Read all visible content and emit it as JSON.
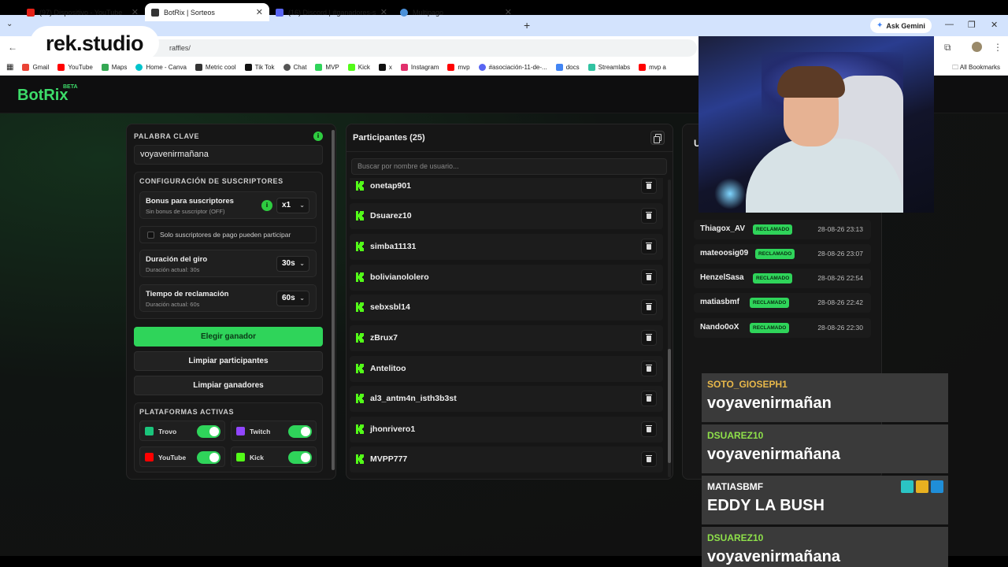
{
  "browser": {
    "tabs": [
      {
        "title": "(97) Dispositivo - YouTube",
        "color": "#e62117"
      },
      {
        "title": "BotRix | Sorteos",
        "color": "#333333"
      },
      {
        "title": "(16) Discord | #ganadores-sorteo",
        "color": "#5865f2"
      },
      {
        "title": "Multipago",
        "color": "#4a90d9"
      }
    ],
    "ask_gemini": "Ask Gemini",
    "url": "raffles/",
    "bookmarks": [
      {
        "label": "Gmail",
        "color": "#ea4335"
      },
      {
        "label": "YouTube",
        "color": "#ff0000"
      },
      {
        "label": "Maps",
        "color": "#34a853"
      },
      {
        "label": "Home - Canva",
        "color": "#00c4cc"
      },
      {
        "label": "Metric cool",
        "color": "#333333"
      },
      {
        "label": "Tik Tok",
        "color": "#111111"
      },
      {
        "label": "Chat",
        "color": "#555555"
      },
      {
        "label": "MVP",
        "color": "#2fd45a"
      },
      {
        "label": "Kick",
        "color": "#53fc18"
      },
      {
        "label": "x",
        "color": "#111111"
      },
      {
        "label": "Instagram",
        "color": "#e1306c"
      },
      {
        "label": "mvp",
        "color": "#ff0000"
      },
      {
        "label": "#asociación-11-de-...",
        "color": "#5865f2"
      },
      {
        "label": "docs",
        "color": "#4285f4"
      },
      {
        "label": "Streamlabs",
        "color": "#31c3a2"
      },
      {
        "label": "mvp a",
        "color": "#ff0000"
      }
    ],
    "all_bookmarks": "All Bookmarks"
  },
  "overlay": {
    "logo_text": "rek.studio"
  },
  "app": {
    "brand": "BotRix",
    "beta": "BETA",
    "keyword": {
      "label": "PALABRA CLAVE",
      "value": "voyavenirmañana"
    },
    "subscribers": {
      "title": "CONFIGURACIÓN DE SUSCRIPTORES",
      "bonus_title": "Bonus para suscriptores",
      "bonus_sub": "Sin bonus de suscriptor (OFF)",
      "bonus_value": "x1",
      "paid_only": "Solo suscriptores de pago pueden participar",
      "duration_title": "Duración del giro",
      "duration_sub": "Duración actual: 30s",
      "duration_value": "30s",
      "claim_title": "Tiempo de reclamación",
      "claim_sub": "Duración actual: 60s",
      "claim_value": "60s"
    },
    "buttons": {
      "pick_winner": "Elegir ganador",
      "clear_participants": "Limpiar participantes",
      "clear_winners": "Limpiar ganadores"
    },
    "platforms": {
      "title": "PLATAFORMAS ACTIVAS",
      "items": [
        {
          "name": "Trovo",
          "color": "#1ac47b",
          "enabled": true
        },
        {
          "name": "Twitch",
          "color": "#9146ff",
          "enabled": true
        },
        {
          "name": "YouTube",
          "color": "#ff0000",
          "enabled": true
        },
        {
          "name": "Kick",
          "color": "#53fc18",
          "enabled": true
        }
      ]
    },
    "participants": {
      "title": "Participantes (25)",
      "search_placeholder": "Buscar por nombre de usuario...",
      "list": [
        "onetap901",
        "Dsuarez10",
        "simba11131",
        "bolivianololero",
        "sebxsbl14",
        "zBrux7",
        "Antelitoo",
        "al3_antm4n_isth3b3st",
        "jhonrivero1",
        "MVPP777"
      ]
    },
    "winners": {
      "title": "U",
      "badge": "RECLAMADO",
      "list": [
        {
          "name": "Thiagox_AV",
          "date": "28-08-26 23:13"
        },
        {
          "name": "mateoosig09",
          "date": "28-08-26 23:07"
        },
        {
          "name": "HenzelSasa",
          "date": "28-08-26 22:54"
        },
        {
          "name": "matiasbmf",
          "date": "28-08-26 22:42"
        },
        {
          "name": "Nando0oX",
          "date": "28-08-26 22:30"
        }
      ]
    }
  },
  "chat": [
    {
      "user": "SOTO_GIOSEPH1",
      "message": "voyavenirmañan",
      "color": "#e8b84a"
    },
    {
      "user": "DSUAREZ10",
      "message": "voyavenirmañana",
      "color": "#8ee04a"
    },
    {
      "user": "MATIASBMF",
      "message": "EDDY LA BUSH",
      "color": "#ffffff"
    },
    {
      "user": "DSUAREZ10",
      "message": "voyavenirmañana",
      "color": "#8ee04a"
    }
  ],
  "colors": {
    "accent": "#2fd45a",
    "panel": "#161616"
  }
}
